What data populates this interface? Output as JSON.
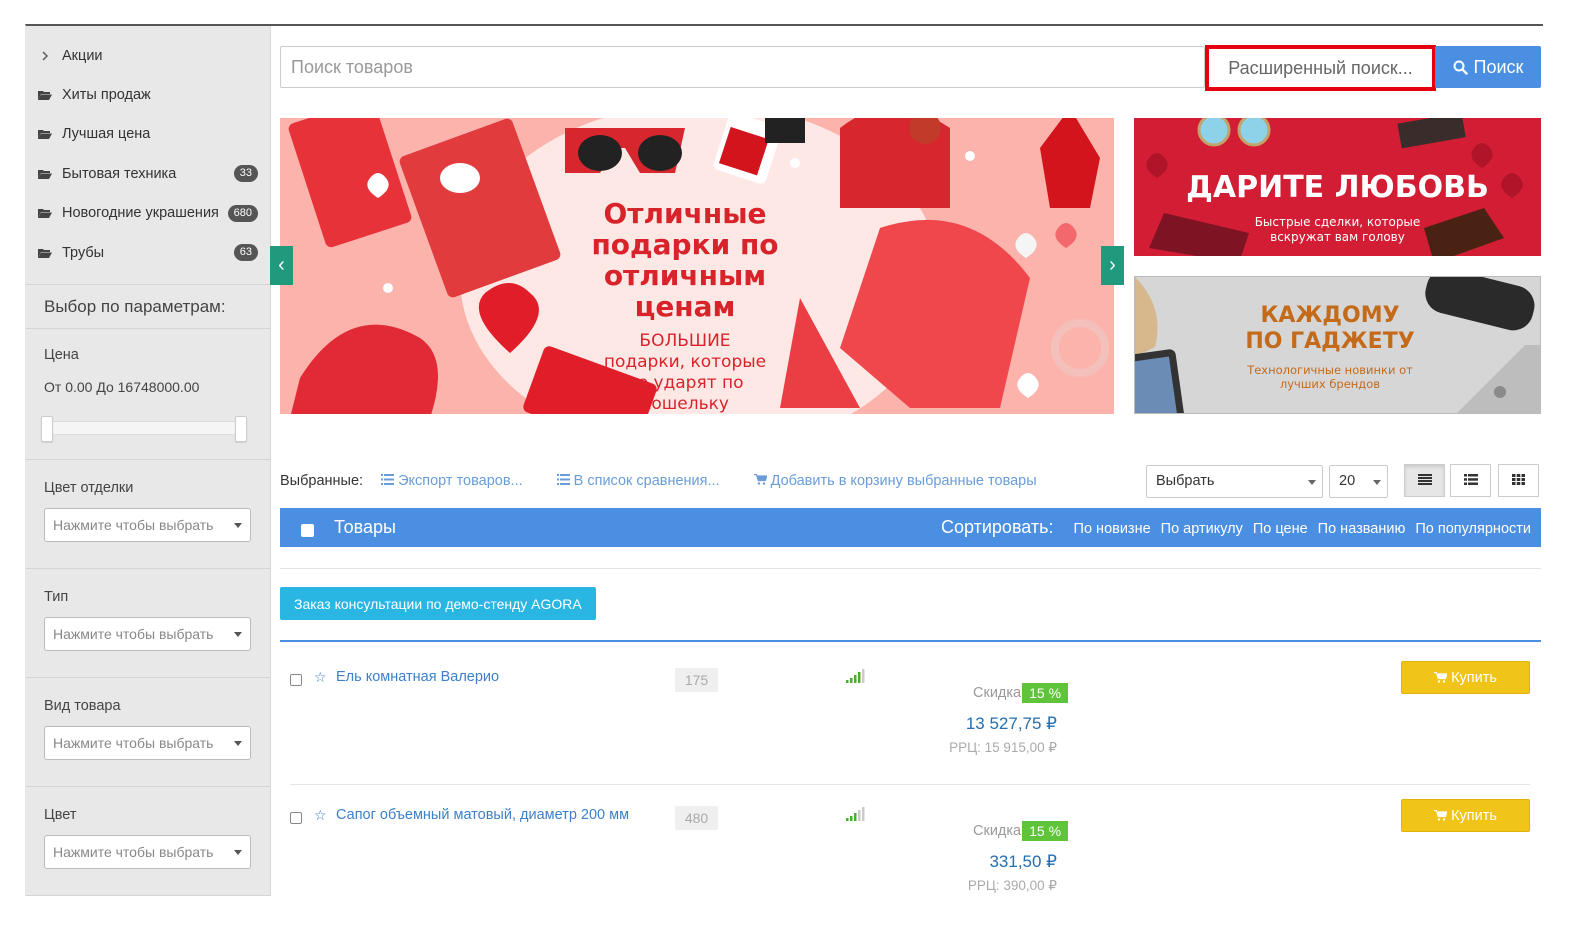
{
  "sidebar": {
    "menu": [
      {
        "label": "Акции",
        "icon": "chevron-right-icon",
        "badge": ""
      },
      {
        "label": "Хиты продаж",
        "icon": "folder-open-icon",
        "badge": ""
      },
      {
        "label": "Лучшая цена",
        "icon": "folder-open-icon",
        "badge": ""
      },
      {
        "label": "Бытовая техника",
        "icon": "folder-open-icon",
        "badge": "33"
      },
      {
        "label": "Новогодние украшения",
        "icon": "folder-open-icon",
        "badge": "680"
      },
      {
        "label": "Трубы",
        "icon": "folder-open-icon",
        "badge": "63"
      }
    ],
    "params_title": "Выбор по параметрам:",
    "price_label": "Цена",
    "price_range_text": "От 0.00 До 16748000.00",
    "filters": [
      {
        "label": "Цвет отделки",
        "placeholder": "Нажмите чтобы выбрать"
      },
      {
        "label": "Тип",
        "placeholder": "Нажмите чтобы выбрать"
      },
      {
        "label": "Вид товара",
        "placeholder": "Нажмите чтобы выбрать"
      },
      {
        "label": "Цвет",
        "placeholder": "Нажмите чтобы выбрать"
      }
    ]
  },
  "search": {
    "placeholder": "Поиск товаров",
    "advanced_label": "Расширенный поиск...",
    "button_label": "Поиск",
    "highlight_color": "#e5000f"
  },
  "banners": {
    "main_title": [
      "Отличные",
      "подарки по",
      "отличным",
      "ценам"
    ],
    "main_sub": [
      "БОЛЬШИЕ",
      "подарки, которые",
      "не ударят по",
      "кошельку"
    ],
    "right1_title": "ДАРИТЕ ЛЮБОВЬ",
    "right1_sub": [
      "Быстрые сделки, которые",
      "вскружат вам голову"
    ],
    "right2_title": [
      "КАЖДОМУ",
      "ПО ГАДЖЕТУ"
    ],
    "right2_sub": [
      "Технологичные новинки от",
      "лучших брендов"
    ],
    "prev_arrow": "‹",
    "next_arrow": "›"
  },
  "toolbar": {
    "selected_label": "Выбранные:",
    "export_label": "Экспорт товаров...",
    "compare_label": "В список сравнения...",
    "cart_label": "Добавить в корзину выбранные товары",
    "action_select": "Выбрать",
    "per_page": "20"
  },
  "bluebar": {
    "title": "Товары",
    "sort_label": "Сортировать:",
    "sort_options": [
      "По новизне",
      "По артикулу",
      "По цене",
      "По названию",
      "По популярности"
    ]
  },
  "consult_button": "Заказ консультации по демо-стенду AGORA",
  "products": [
    {
      "name": "Ель комнатная Валерио",
      "qty": "175",
      "discount_label": "Скидка",
      "discount_pct": "15 %",
      "price": "13 527,75 ₽",
      "rrc": "РРЦ: 15 915,00 ₽",
      "buy_label": "Купить"
    },
    {
      "name": "Сапог объемный матовый, диаметр 200 мм",
      "qty": "480",
      "discount_label": "Скидка",
      "discount_pct": "15 %",
      "price": "331,50 ₽",
      "rrc": "РРЦ: 390,00 ₽",
      "buy_label": "Купить"
    }
  ],
  "colors": {
    "accent_blue": "#4a8fe2",
    "buy_yellow": "#f0c419",
    "discount_green": "#5fc43a",
    "consult_cyan": "#29b6e3",
    "banner_arrow_teal": "#1f9a7c"
  }
}
